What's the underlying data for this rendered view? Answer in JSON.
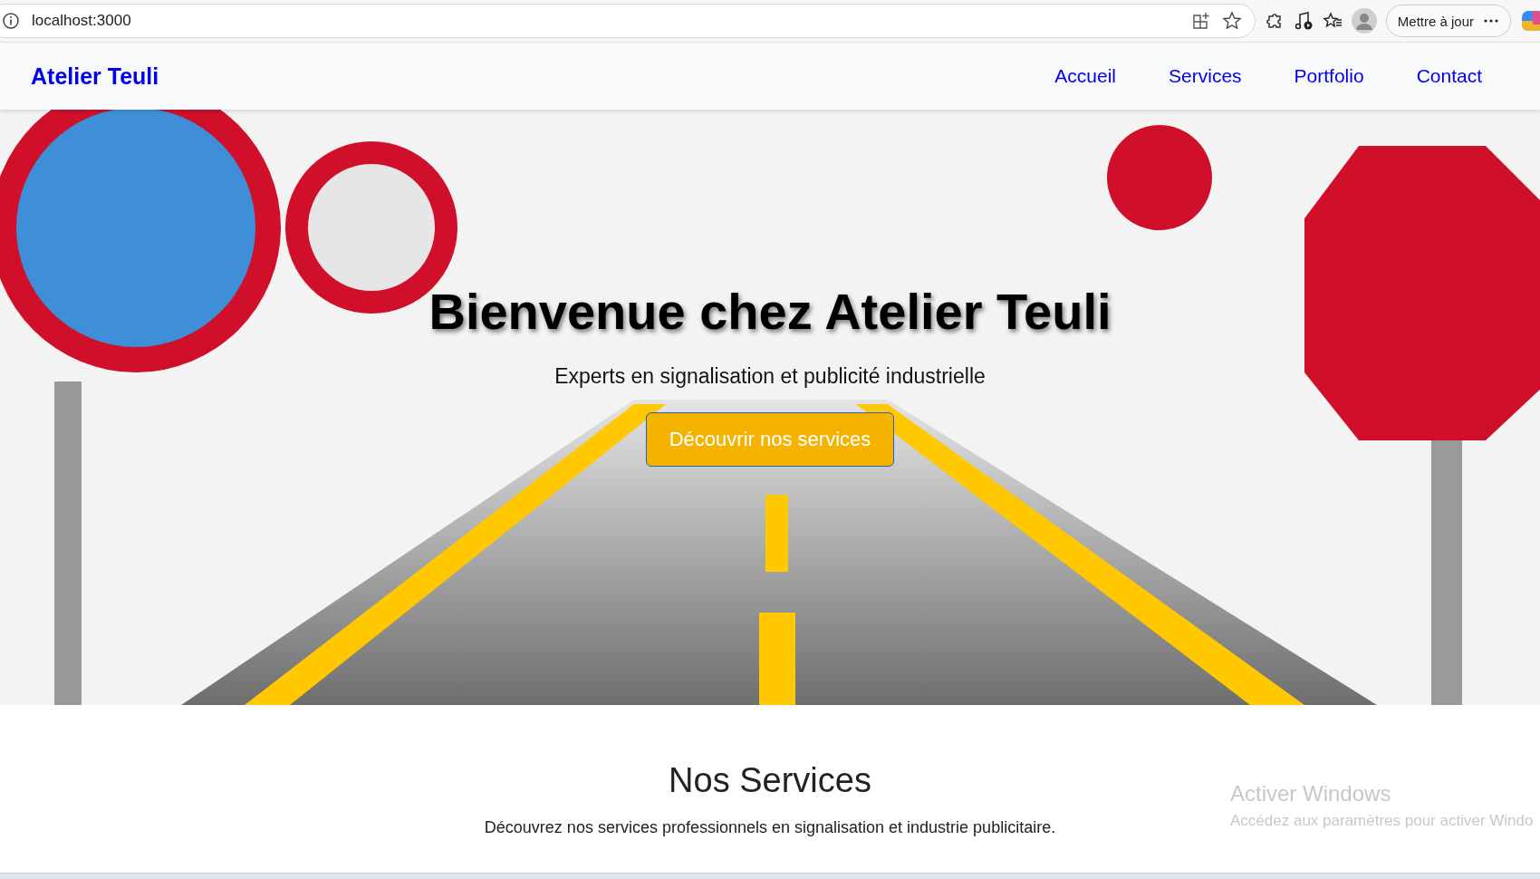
{
  "browser": {
    "url": "localhost:3000",
    "update_button": "Mettre à jour"
  },
  "navbar": {
    "brand": "Atelier Teuli",
    "links": [
      {
        "label": "Accueil"
      },
      {
        "label": "Services"
      },
      {
        "label": "Portfolio"
      },
      {
        "label": "Contact"
      }
    ]
  },
  "hero": {
    "title": "Bienvenue chez Atelier Teuli",
    "subtitle": "Experts en signalisation et publicité industrielle",
    "button": "Découvrir nos services"
  },
  "services": {
    "title": "Nos Services",
    "description": "Découvrez nos services professionnels en signalisation et industrie publicitaire."
  },
  "activation_notice": {
    "title": "Activer Windows",
    "text": "Accédez aux paramètres pour activer Windo"
  }
}
